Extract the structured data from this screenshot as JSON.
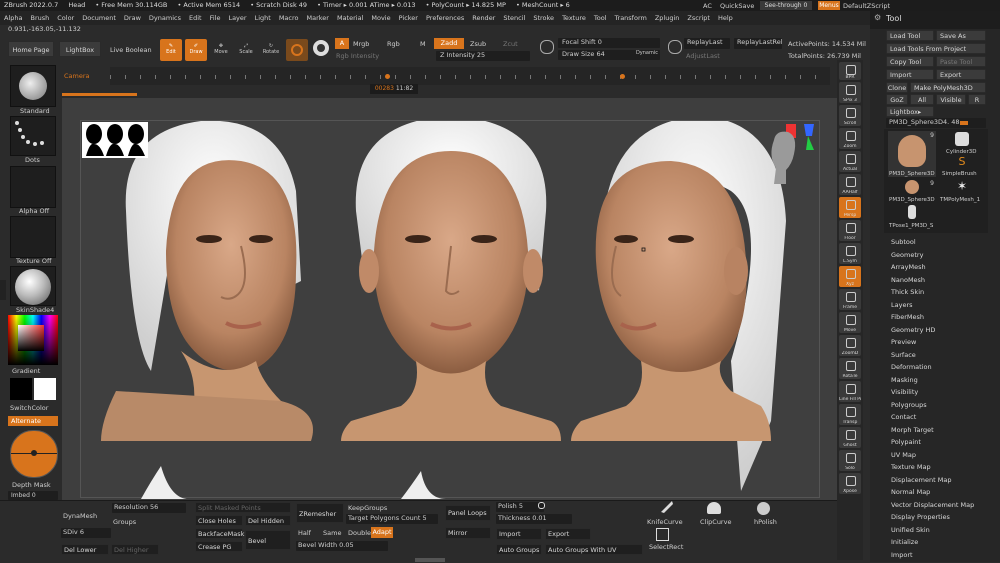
{
  "titlebar": {
    "app": "ZBrush 2022.0.7",
    "head": "Head",
    "free_mem": "• Free Mem 30.114GB",
    "active_mem": "• Active Mem 6514",
    "scratch": "• Scratch Disk 49",
    "timer": "• Timer ▸ 0.001 ATime ▸ 0.013",
    "polycount": "• PolyCount ▸ 14.825 MP",
    "meshcount": "• MeshCount ▸ 6",
    "ac": "AC",
    "quicksave": "QuickSave",
    "seethrough": "See-through  0",
    "menus": "Menus",
    "defaultzscript": "DefaultZScript"
  },
  "menubar": [
    "Alpha",
    "Brush",
    "Color",
    "Document",
    "Draw",
    "Dynamics",
    "Edit",
    "File",
    "Layer",
    "Light",
    "Macro",
    "Marker",
    "Material",
    "Movie",
    "Picker",
    "Preferences",
    "Render",
    "Stencil",
    "Stroke",
    "Texture",
    "Tool",
    "Transform",
    "Zplugin",
    "Zscript",
    "Help"
  ],
  "coords": "0.931,-163.05,-11.132",
  "toptools": {
    "home_page": "Home Page",
    "lightbox": "LightBox",
    "live_boolean": "Live Boolean",
    "edit": "Edit",
    "draw": "Draw",
    "move": "Move",
    "scale": "Scale",
    "rotate": "Rotate",
    "a": "A",
    "mrgb": "Mrgb",
    "rgb": "Rgb",
    "m": "M",
    "zadd": "Zadd",
    "zsub": "Zsub",
    "zcut": "Zcut",
    "rgb_intensity": "Rgb Intensity",
    "z_intensity": "Z Intensity 25",
    "focal_shift": "Focal Shift 0",
    "draw_size": "Draw Size 64",
    "dynamic": "Dynamic",
    "replaylast": "ReplayLast",
    "replaylastrel": "ReplayLastRel",
    "active_points": "ActivePoints: 14.534 Mil",
    "total_points": "TotalPoints: 26.739 Mil",
    "adjustlast": "AdjustLast"
  },
  "timeline": {
    "label": "Camera",
    "frame": "00283",
    "time": "11:82"
  },
  "leftbar": {
    "standard": "Standard",
    "dots": "Dots",
    "alpha_off": "Alpha Off",
    "texture_off": "Texture Off",
    "material": "SkinShade4",
    "gradient": "Gradient",
    "switchcolor": "SwitchColor",
    "alternate": "Alternate",
    "depth_mask": "Depth Mask",
    "imbed": "Imbed 0"
  },
  "rightshelf": [
    "BPR",
    "SPix 3",
    "Scroll",
    "Zoom",
    "Actual",
    "AAHalf",
    "Persp",
    "Floor",
    "L.Sym",
    "Xyz",
    "Frame",
    "Move",
    "ZoomD",
    "RotaTe",
    "Line Fill PolyF",
    "Transp",
    "Ghost",
    "Solo",
    "Xpose"
  ],
  "toolpanel": {
    "title": "Tool",
    "load_tool": "Load Tool",
    "save_as": "Save As",
    "load_from_project": "Load Tools From Project",
    "copy_tool": "Copy Tool",
    "paste_tool": "Paste Tool",
    "import": "Import",
    "export": "Export",
    "clone": "Clone",
    "make_polymesh": "Make PolyMesh3D",
    "goz": "GoZ",
    "all": "All",
    "visible": "Visible",
    "r": "R",
    "lightbox_tools": "Lightbox▸ Tools",
    "current_tool": "PM3D_Sphere3D4. 48",
    "tools": [
      {
        "name": "PM3D_Sphere3D",
        "count": "9"
      },
      {
        "name": "Cylinder3D",
        "count": ""
      },
      {
        "name": "SimpleBrush",
        "count": ""
      },
      {
        "name": "PM3D_Sphere3D",
        "count": "9"
      },
      {
        "name": "TMPolyMesh_1",
        "count": ""
      },
      {
        "name": "TPose1_PM3D_S",
        "count": ""
      }
    ],
    "sections": [
      "Subtool",
      "Geometry",
      "ArrayMesh",
      "NanoMesh",
      "Thick Skin",
      "Layers",
      "FiberMesh",
      "Geometry HD",
      "Preview",
      "Surface",
      "Deformation",
      "Masking",
      "Visibility",
      "Polygroups",
      "Contact",
      "Morph Target",
      "Polypaint",
      "UV Map",
      "Texture Map",
      "Displacement Map",
      "Normal Map",
      "Vector Displacement Map",
      "Display Properties",
      "Unified Skin",
      "Initialize",
      "Import"
    ]
  },
  "bottombar": {
    "dynamesh": "DynaMesh",
    "resolution": "Resolution 56",
    "groups": "Groups",
    "sdiv": "SDiv 6",
    "del_lower": "Del Lower",
    "del_higher": "Del Higher",
    "split_masked": "Split Masked Points",
    "close_holes": "Close Holes",
    "del_hidden": "Del Hidden",
    "backfacemask": "BackfaceMask",
    "crease_pg": "Crease PG",
    "bevel": "Bevel",
    "zremesher": "ZRemesher",
    "keepgroups": "KeepGroups",
    "target_polys": "Target Polygons Count 5",
    "half": "Half",
    "same": "Same",
    "double": "Double",
    "adapt": "Adapt",
    "bevel_width": "Bevel Width 0.05",
    "panel_loops": "Panel Loops",
    "mirror": "Mirror",
    "polish": "Polish 5",
    "thickness": "Thickness 0.01",
    "import": "Import",
    "export": "Export",
    "auto_groups": "Auto Groups",
    "auto_groups_uv": "Auto Groups With UV",
    "knifecurve": "KnifeCurve",
    "clipcurve": "ClipCurve",
    "hpolish": "hPolish",
    "selectrect": "SelectRect"
  },
  "colors": {
    "accent": "#d8741c",
    "panel": "#2b2b2b",
    "skin": "#c7946f",
    "hair": "#f2f2f2"
  }
}
